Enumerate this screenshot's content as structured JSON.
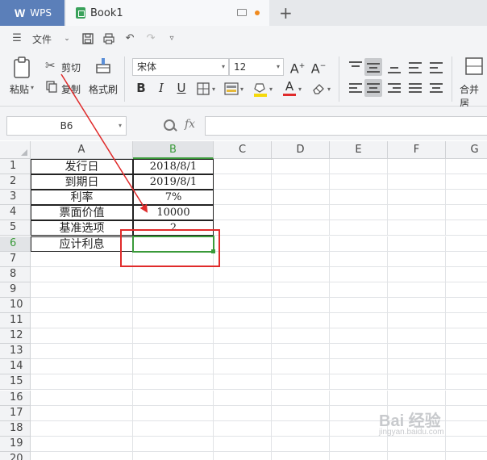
{
  "titlebar": {
    "app_label": "WPS",
    "app_logo": "W",
    "document_tab": "Book1",
    "new_tab_symbol": "+"
  },
  "menubar": {
    "file_label": "文件",
    "icons": [
      "hamburger-icon",
      "chevron-down-icon",
      "save-icon",
      "print-icon",
      "undo-icon",
      "redo-icon",
      "more-icon"
    ]
  },
  "ribbon": {
    "paste_label": "粘贴",
    "cut_label": "剪切",
    "copy_label": "复制",
    "format_painter_label": "格式刷",
    "font_name": "宋体",
    "font_size": "12",
    "grow_font": "A⁺",
    "shrink_font": "A⁻",
    "bold": "B",
    "italic": "I",
    "underline": "U",
    "merge_label": "合并居",
    "accent_color": "#e02b2b"
  },
  "formula_bar": {
    "cell_ref": "B6",
    "fx_label": "fx",
    "formula": ""
  },
  "grid": {
    "columns": [
      "A",
      "B",
      "C",
      "D",
      "E",
      "F",
      "G"
    ],
    "active_column": "B",
    "rows": [
      "1",
      "2",
      "3",
      "4",
      "5",
      "6",
      "7",
      "8",
      "9",
      "10",
      "11",
      "12",
      "13",
      "14",
      "15",
      "16",
      "17",
      "18",
      "19",
      "20"
    ],
    "active_row": "6",
    "data": [
      {
        "label": "发行日",
        "value": "2018/8/1"
      },
      {
        "label": "到期日",
        "value": "2019/8/1"
      },
      {
        "label": "利率",
        "value": "7%"
      },
      {
        "label": "票面价值",
        "value": "10000"
      },
      {
        "label": "基准选项",
        "value": "2"
      },
      {
        "label": "应计利息",
        "value": ""
      }
    ],
    "selection_color": "#3a9a3a",
    "annotation_color": "#e02b2b"
  },
  "watermark": {
    "main": "Bai 经验",
    "sub": "jingyan.baidu.com"
  }
}
